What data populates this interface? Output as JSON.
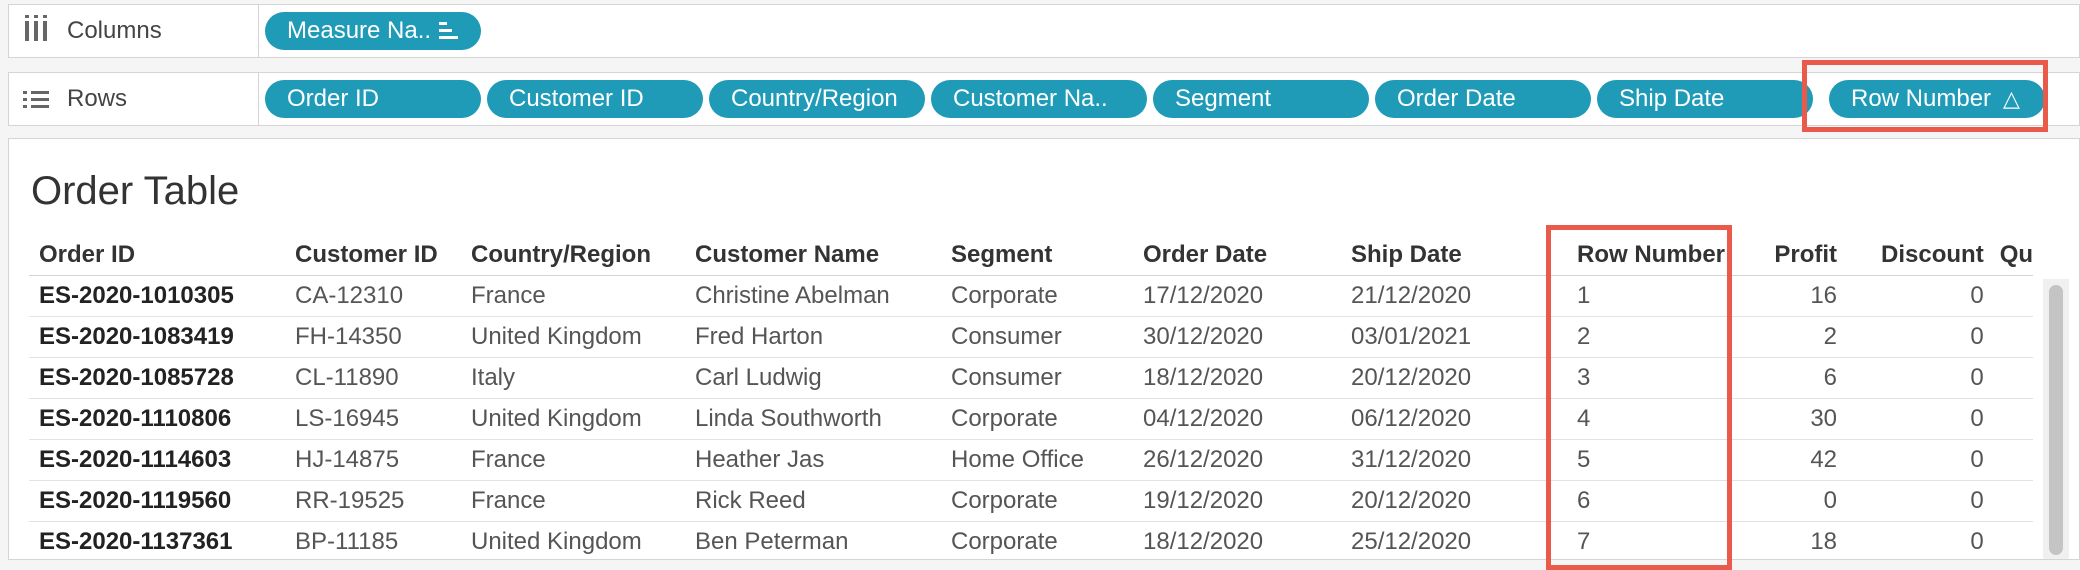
{
  "shelves": {
    "columns": {
      "label": "Columns",
      "pills": [
        {
          "label": "Measure Na..",
          "icon": "sort-descending-icon"
        }
      ]
    },
    "rows": {
      "label": "Rows",
      "pills": [
        {
          "label": "Order ID"
        },
        {
          "label": "Customer ID"
        },
        {
          "label": "Country/Region"
        },
        {
          "label": "Customer Na.."
        },
        {
          "label": "Segment"
        },
        {
          "label": "Order Date"
        },
        {
          "label": "Ship Date"
        },
        {
          "label": "Row Number",
          "icon": "delta-icon",
          "glyph": "△"
        }
      ]
    }
  },
  "view": {
    "title": "Order Table",
    "columns": [
      "Order ID",
      "Customer ID",
      "Country/Region",
      "Customer Name",
      "Segment",
      "Order Date",
      "Ship Date",
      "Row Number",
      "Profit",
      "Discount",
      "Qu"
    ],
    "rows": [
      [
        "ES-2020-1010305",
        "CA-12310",
        "France",
        "Christine Abelman",
        "Corporate",
        "17/12/2020",
        "21/12/2020",
        "1",
        "16",
        "0"
      ],
      [
        "ES-2020-1083419",
        "FH-14350",
        "United Kingdom",
        "Fred Harton",
        "Consumer",
        "30/12/2020",
        "03/01/2021",
        "2",
        "2",
        "0"
      ],
      [
        "ES-2020-1085728",
        "CL-11890",
        "Italy",
        "Carl Ludwig",
        "Consumer",
        "18/12/2020",
        "20/12/2020",
        "3",
        "6",
        "0"
      ],
      [
        "ES-2020-1110806",
        "LS-16945",
        "United Kingdom",
        "Linda Southworth",
        "Corporate",
        "04/12/2020",
        "06/12/2020",
        "4",
        "30",
        "0"
      ],
      [
        "ES-2020-1114603",
        "HJ-14875",
        "France",
        "Heather Jas",
        "Home Office",
        "26/12/2020",
        "31/12/2020",
        "5",
        "42",
        "0"
      ],
      [
        "ES-2020-1119560",
        "RR-19525",
        "France",
        "Rick Reed",
        "Corporate",
        "19/12/2020",
        "20/12/2020",
        "6",
        "0",
        "0"
      ],
      [
        "ES-2020-1137361",
        "BP-11185",
        "United Kingdom",
        "Ben Peterman",
        "Corporate",
        "18/12/2020",
        "25/12/2020",
        "7",
        "18",
        "0"
      ]
    ]
  },
  "colors": {
    "pill": "#1f9bb8",
    "highlight": "#ea5a4a"
  }
}
